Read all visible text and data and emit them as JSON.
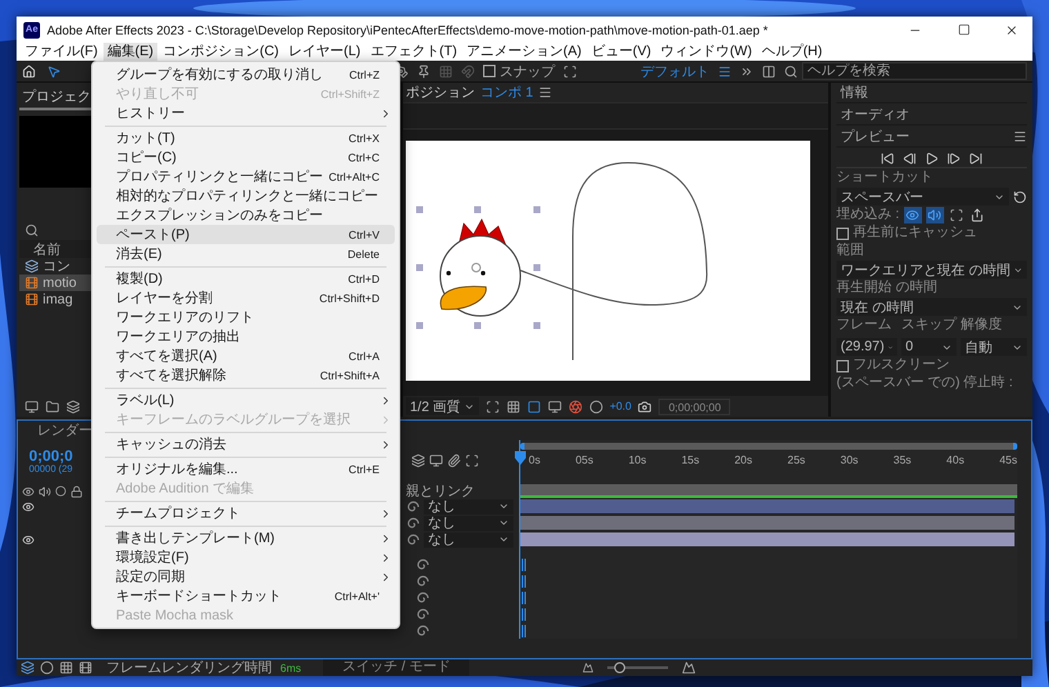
{
  "window": {
    "logo": "Ae",
    "title": "Adobe After Effects 2023 - C:\\Storage\\Develop Repository\\iPentecAfterEffects\\demo-move-motion-path\\move-motion-path-01.aep *"
  },
  "menu_bar": [
    {
      "label": "ファイル(F)",
      "selected": false
    },
    {
      "label": "編集(E)",
      "selected": true
    },
    {
      "label": "コンポジション(C)",
      "selected": false
    },
    {
      "label": "レイヤー(L)",
      "selected": false
    },
    {
      "label": "エフェクト(T)",
      "selected": false
    },
    {
      "label": "アニメーション(A)",
      "selected": false
    },
    {
      "label": "ビュー(V)",
      "selected": false
    },
    {
      "label": "ウィンドウ(W)",
      "selected": false
    },
    {
      "label": "ヘルプ(H)",
      "selected": false
    }
  ],
  "toolbar": {
    "snap": {
      "label": "スナップ",
      "checked": false
    },
    "workspace": "デフォルト",
    "help_search": {
      "placeholder": "ヘルプを検索"
    }
  },
  "edit_menu": [
    {
      "kind": "item",
      "label": "グループを有効にするの取り消し",
      "shortcut": "Ctrl+Z",
      "submenu": false,
      "disabled": false,
      "selected": false
    },
    {
      "kind": "item",
      "label": "やり直し不可",
      "shortcut": "Ctrl+Shift+Z",
      "submenu": false,
      "disabled": true,
      "selected": false
    },
    {
      "kind": "item",
      "label": "ヒストリー",
      "submenu": true,
      "disabled": false,
      "selected": false
    },
    {
      "kind": "separator"
    },
    {
      "kind": "item",
      "label": "カット(T)",
      "shortcut": "Ctrl+X",
      "submenu": false,
      "disabled": false,
      "selected": false
    },
    {
      "kind": "item",
      "label": "コピー(C)",
      "shortcut": "Ctrl+C",
      "submenu": false,
      "disabled": false,
      "selected": false
    },
    {
      "kind": "item",
      "label": "プロパティリンクと一緒にコピー",
      "shortcut": "Ctrl+Alt+C",
      "submenu": false,
      "disabled": false,
      "selected": false
    },
    {
      "kind": "item",
      "label": "相対的なプロパティリンクと一緒にコピー",
      "submenu": false,
      "disabled": false,
      "selected": false
    },
    {
      "kind": "item",
      "label": "エクスプレッションのみをコピー",
      "submenu": false,
      "disabled": false,
      "selected": false
    },
    {
      "kind": "item",
      "label": "ペースト(P)",
      "shortcut": "Ctrl+V",
      "submenu": false,
      "disabled": false,
      "selected": true
    },
    {
      "kind": "item",
      "label": "消去(E)",
      "shortcut": "Delete",
      "submenu": false,
      "disabled": false,
      "selected": false
    },
    {
      "kind": "separator"
    },
    {
      "kind": "item",
      "label": "複製(D)",
      "shortcut": "Ctrl+D",
      "submenu": false,
      "disabled": false,
      "selected": false
    },
    {
      "kind": "item",
      "label": "レイヤーを分割",
      "shortcut": "Ctrl+Shift+D",
      "submenu": false,
      "disabled": false,
      "selected": false
    },
    {
      "kind": "item",
      "label": "ワークエリアのリフト",
      "submenu": false,
      "disabled": false,
      "selected": false
    },
    {
      "kind": "item",
      "label": "ワークエリアの抽出",
      "submenu": false,
      "disabled": false,
      "selected": false
    },
    {
      "kind": "item",
      "label": "すべてを選択(A)",
      "shortcut": "Ctrl+A",
      "submenu": false,
      "disabled": false,
      "selected": false
    },
    {
      "kind": "item",
      "label": "すべてを選択解除",
      "shortcut": "Ctrl+Shift+A",
      "submenu": false,
      "disabled": false,
      "selected": false
    },
    {
      "kind": "separator"
    },
    {
      "kind": "item",
      "label": "ラベル(L)",
      "submenu": true,
      "disabled": false,
      "selected": false
    },
    {
      "kind": "item",
      "label": "キーフレームのラベルグループを選択",
      "submenu": true,
      "disabled": true,
      "selected": false
    },
    {
      "kind": "separator"
    },
    {
      "kind": "item",
      "label": "キャッシュの消去",
      "submenu": true,
      "disabled": false,
      "selected": false
    },
    {
      "kind": "separator"
    },
    {
      "kind": "item",
      "label": "オリジナルを編集...",
      "shortcut": "Ctrl+E",
      "submenu": false,
      "disabled": false,
      "selected": false
    },
    {
      "kind": "item",
      "label": "Adobe Audition で編集",
      "submenu": false,
      "disabled": true,
      "selected": false
    },
    {
      "kind": "separator"
    },
    {
      "kind": "item",
      "label": "チームプロジェクト",
      "submenu": true,
      "disabled": false,
      "selected": false
    },
    {
      "kind": "separator"
    },
    {
      "kind": "item",
      "label": "書き出しテンプレート(M)",
      "submenu": true,
      "disabled": false,
      "selected": false
    },
    {
      "kind": "item",
      "label": "環境設定(F)",
      "submenu": true,
      "disabled": false,
      "selected": false
    },
    {
      "kind": "item",
      "label": "設定の同期",
      "submenu": true,
      "disabled": false,
      "selected": false
    },
    {
      "kind": "item",
      "label": "キーボードショートカット",
      "shortcut": "Ctrl+Alt+'",
      "submenu": false,
      "disabled": false,
      "selected": false
    },
    {
      "kind": "item",
      "label": "Paste Mocha mask",
      "submenu": false,
      "disabled": true,
      "selected": false
    }
  ],
  "project_panel": {
    "tab": "プロジェク",
    "column": "名前",
    "items": [
      {
        "name": "コン",
        "kind": "comp",
        "selected": false
      },
      {
        "name": "motio",
        "kind": "footage",
        "selected": true
      },
      {
        "name": "imag",
        "kind": "footage",
        "selected": false
      }
    ]
  },
  "composition": {
    "tab": "ポジション",
    "comp_name": "コンポ 1",
    "quality": "1/2 画質",
    "exposure": "+0.0",
    "timecode": "0;00;00;00"
  },
  "preview_panel": {
    "sections": [
      "情報",
      "オーディオ"
    ],
    "title": "プレビュー",
    "shortcut_label": "ショートカット",
    "shortcut": "スペースバー",
    "embed_label": "埋め込み :",
    "embed": [
      {
        "kind": "video",
        "on": true
      },
      {
        "kind": "audio",
        "on": true
      },
      {
        "kind": "overlay",
        "on": false
      }
    ],
    "cache_before": {
      "label": "再生前にキャッシュ",
      "checked": false
    },
    "range_label": "範囲",
    "range": "ワークエリアと現在 の時間",
    "start_label": "再生開始 の時間",
    "start": "現在 の時間",
    "frame_label": "フレーム",
    "skip_label": "スキップ",
    "resolution_label": "解像度",
    "frame": "(29.97)",
    "skip": "0",
    "resolution": "自動",
    "fullscreen": {
      "label": "フルスクリーン",
      "checked": false
    },
    "stop_label": "(スペースバー での) 停止時 :"
  },
  "timeline": {
    "tab": "レンダー",
    "timecode": "0;00;0",
    "frame": "00000 (29",
    "parent_header": "親とリンク",
    "ruler": [
      "0s",
      "05s",
      "10s",
      "15s",
      "20s",
      "25s",
      "30s",
      "35s",
      "40s",
      "45s"
    ],
    "layers": [
      {
        "visible": true,
        "parent": "なし",
        "color": "#525d8f"
      },
      {
        "visible": false,
        "parent": "なし",
        "color": "#6e6d7a"
      },
      {
        "visible": true,
        "parent": "なし",
        "color": "#9593b8"
      }
    ],
    "property_rows": [
      {
        "keyframe": true
      },
      {
        "keyframe": true
      },
      {
        "keyframe": true
      },
      {
        "keyframe": true
      },
      {
        "keyframe": true
      }
    ]
  },
  "status_bar": {
    "label": "フレームレンダリング時間",
    "render_time": "6ms",
    "toggle": "スイッチ / モード",
    "zoom": {
      "level": 0.2
    }
  }
}
